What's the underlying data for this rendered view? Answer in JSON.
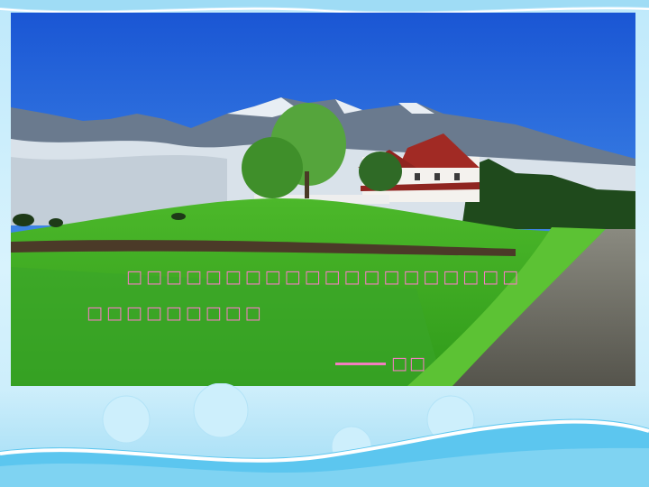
{
  "quote": {
    "line1": "□□□□□□□□□□□□□□□□□□□□",
    "line2": "□□□□□□□□□",
    "author": "□□"
  },
  "colors": {
    "text": "#f27ec0",
    "frame": "#bfe9fb",
    "sky": "#1e5fd6",
    "grass": "#3fae24"
  }
}
